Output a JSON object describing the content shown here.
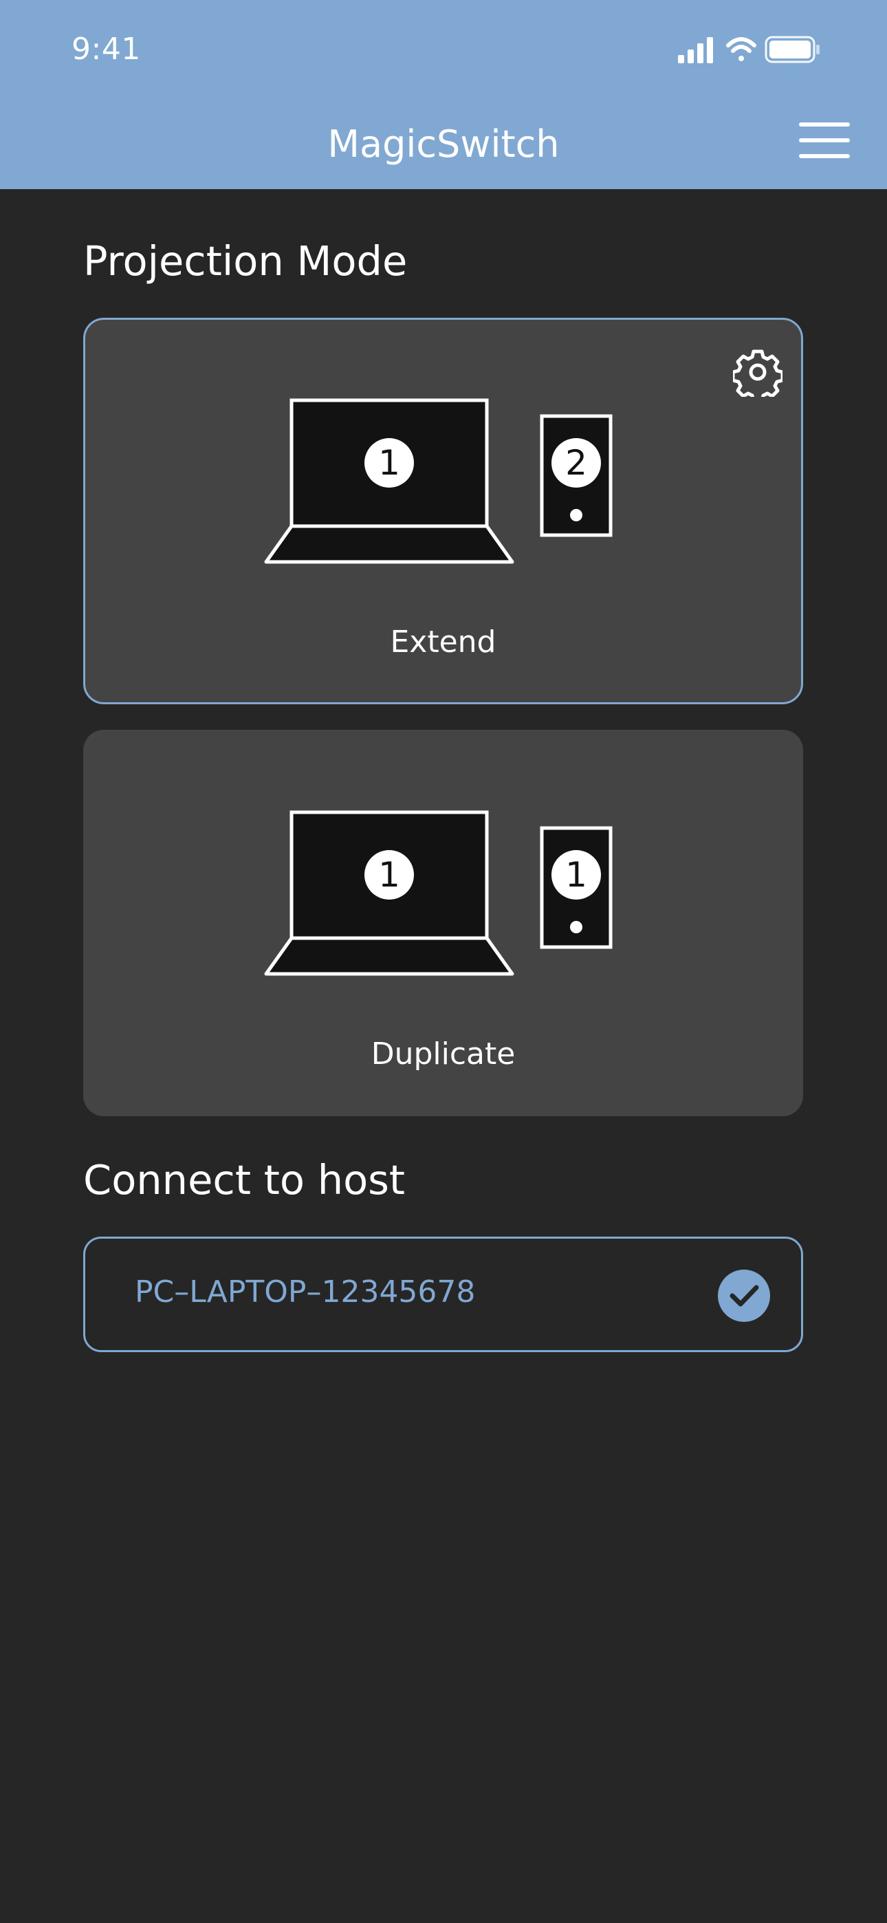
{
  "status_bar": {
    "time": "9:41",
    "icons": [
      "signal-icon",
      "wifi-icon",
      "battery-icon"
    ]
  },
  "header": {
    "title": "MagicSwitch",
    "menu_icon": "hamburger-menu-icon"
  },
  "projection": {
    "section_title": "Projection Mode",
    "modes": [
      {
        "label": "Extend",
        "selected": true,
        "laptop_number": "1",
        "phone_number": "2",
        "settings_icon": "gear-icon"
      },
      {
        "label": "Duplicate",
        "selected": false,
        "laptop_number": "1",
        "phone_number": "1"
      }
    ]
  },
  "host": {
    "section_title": "Connect to host",
    "name": "PC–LAPTOP–12345678",
    "connected": true,
    "status_icon": "check-circle-icon"
  },
  "colors": {
    "accent": "#80a8d2",
    "background": "#262626",
    "card": "#444444",
    "text": "#ffffff"
  }
}
